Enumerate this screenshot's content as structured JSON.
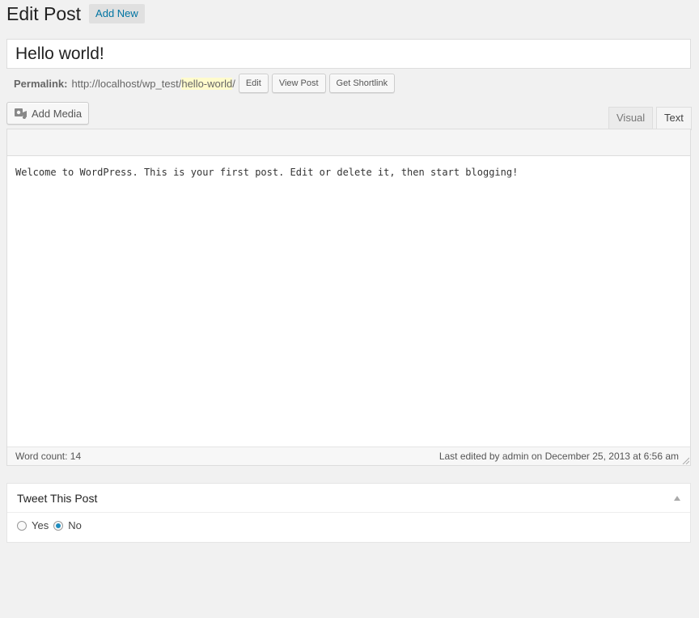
{
  "header": {
    "title": "Edit Post",
    "add_new_label": "Add New"
  },
  "post": {
    "title": "Hello world!"
  },
  "permalink": {
    "label": "Permalink:",
    "base_url": "http://localhost/wp_test/",
    "slug": "hello-world",
    "trailing": "/",
    "buttons": [
      "Edit",
      "View Post",
      "Get Shortlink"
    ]
  },
  "toolbar": {
    "add_media_label": "Add Media"
  },
  "editor_tabs": {
    "visual": "Visual",
    "text": "Text",
    "active": "Text"
  },
  "editor": {
    "content": "Welcome to WordPress. This is your first post. Edit or delete it, then start blogging!"
  },
  "status_bar": {
    "word_count": "Word count: 14",
    "last_edited": "Last edited by admin on December 25, 2013 at 6:56 am"
  },
  "metabox": {
    "title": "Tweet This Post",
    "options": [
      {
        "label": "Yes",
        "checked": false
      },
      {
        "label": "No",
        "checked": true
      }
    ]
  },
  "colors": {
    "accent": "#0074a2",
    "radio_checked": "#1e8cbe",
    "slug_highlight": "#fffbcc",
    "background": "#f1f1f1"
  }
}
